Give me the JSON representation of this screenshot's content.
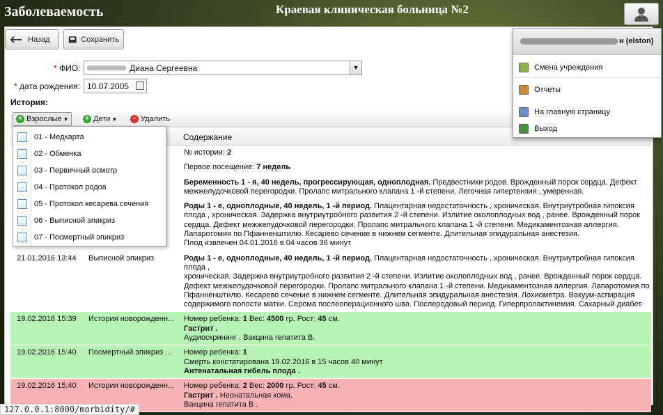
{
  "header": {
    "app_title": "Заболеваемость",
    "hospital": "Краевая клиническая больница №2"
  },
  "toolbar": {
    "back_label": "Назад",
    "save_label": "Сохранить"
  },
  "form": {
    "fio_label": "ФИО:",
    "fio_value": "Диана Сергеевна",
    "birth_label": "дата рождения:",
    "birth_value": "10.07.2005",
    "history_label": "История:"
  },
  "history_toolbar": {
    "adults": "Взрослые",
    "children": "Дети",
    "delete": "Удалить"
  },
  "table": {
    "header_content": "Содержание"
  },
  "rows": [
    {
      "date": "",
      "type": "",
      "lines": [
        [
          [
            "№ истории: ",
            false
          ],
          [
            "2",
            true
          ]
        ]
      ]
    },
    {
      "date": "",
      "type": "",
      "lines": [
        [
          [
            "Первое посещение: ",
            false
          ],
          [
            "7 недель",
            true
          ]
        ]
      ]
    },
    {
      "date": "",
      "type": "",
      "lines": [
        [
          [
            "Беременность 1 - я, 40 недель, прогрессирующая, одноплодная.",
            true
          ],
          [
            " Предвестники родов. Врожденный порок сердца. Дефект",
            false
          ]
        ],
        [
          [
            "межжелудочковой перегородки. Пролапс митрального клапана 1 -й степени. Легочная гипертензия , умеренная.",
            false
          ]
        ]
      ]
    },
    {
      "date": "",
      "type": "",
      "lines": [
        [
          [
            "Роды 1 - е, одноплодные, 40 недель, 1 -й период.",
            true
          ],
          [
            " Плацентарная недостаточность , хроническая. Внутриутробная гипоксия",
            false
          ]
        ],
        [
          [
            "плода , хроническая. Задержка внутриутробного развития 2 -й степени. Излитие околоплодных вод , ранее. Врожденный порок",
            false
          ]
        ],
        [
          [
            "сердца. Дефект межжелудочковой перегородки. Пролапс митрального клапана 1 -й степени. Медикаментозная аллергия.",
            false
          ]
        ],
        [
          [
            "Лапаротомия по Пфанненштилю. Кесарево сечение в нижнем сегменте. Длительная эпидуральная анестезия.",
            false
          ]
        ],
        [
          [
            "Плод извлечен 04.01.2016 в 04 часов 36 минут",
            false
          ]
        ]
      ]
    },
    {
      "date": "21.01.2016 13:44",
      "type": "Выписной эпикриз",
      "lines": [
        [
          [
            "Роды 1 - е, одноплодные, 40 недель, 1 -й период.",
            true
          ],
          [
            " Плацентарная недостаточность , хроническая. Внутриутробная гипоксия плода ,",
            false
          ]
        ],
        [
          [
            "хроническая. Задержка внутриутробного развития 2 -й степени. Излитие околоплодных вод , ранее. Врожденный порок сердца.",
            false
          ]
        ],
        [
          [
            "Дефект межжелудочковой перегородки. Пролапс митрального клапана 1 -й степени. Медикаментозная аллергия. Лапаротомия по",
            false
          ]
        ],
        [
          [
            "Пфанненштилю. Кесарево сечение в нижнем сегменте. Длительная эпидуральная анестезия. Лохиометра. Вакуум-аспирация",
            false
          ]
        ],
        [
          [
            "содержимого полости матки. Серома послеоперационного шва. Послеродовый период. Гиперпролактинемия. Сахарный диабет.",
            false
          ]
        ]
      ]
    },
    {
      "date": "19.02.2016 15:39",
      "type": "История новорожденн...",
      "bg": "#b7f3b7",
      "lines": [
        [
          [
            "Номер ребенка: ",
            false
          ],
          [
            "1",
            true
          ],
          [
            " Вес: ",
            false
          ],
          [
            "4500",
            true
          ],
          [
            " гр. Рост: ",
            false
          ],
          [
            "45",
            true
          ],
          [
            " см.",
            false
          ]
        ],
        [
          [
            "Гастрит .",
            true
          ]
        ],
        [
          [
            "Аудиоскрининг . Вакцина гепатита В.",
            false
          ]
        ]
      ]
    },
    {
      "date": "19.02.2016 15:40",
      "type": "Посмертный эпикриз ...",
      "bg": "#b7f3b7",
      "lines": [
        [
          [
            "Номер ребенка: ",
            false
          ],
          [
            "1",
            true
          ]
        ],
        [
          [
            "Смерть констатирована 19.02.2016 в 15 часов 40 минут",
            false
          ]
        ],
        [
          [
            "Антенатальная гибель плода .",
            true
          ]
        ]
      ]
    },
    {
      "date": "19.02.2016 15:40",
      "type": "История новорожденн...",
      "bg": "#f7b3b3",
      "lines": [
        [
          [
            "Номер ребенка: ",
            false
          ],
          [
            "2",
            true
          ],
          [
            " Вес: ",
            false
          ],
          [
            "2000",
            true
          ],
          [
            " гр. Рост: ",
            false
          ],
          [
            "45",
            true
          ],
          [
            " см.",
            false
          ]
        ],
        [
          [
            "Гастрит .",
            true
          ],
          [
            " Неонатальная кома.",
            false
          ]
        ],
        [
          [
            "Вакцина гепатита В .",
            false
          ]
        ]
      ]
    }
  ],
  "dropdown": [
    "01 - Медкарта",
    "02 - Обменка",
    "03 - Первичный осмотр",
    "04 - Протокол родов",
    "05 - Протокол кесарева сечения",
    "06 - Выписной эпикриз",
    "07 - Посмертный эпикриз"
  ],
  "user_menu": {
    "username": "н (elston)",
    "items": [
      {
        "label": "Смена учреждения",
        "icon": "building-icon"
      },
      {
        "label": "Отчеты",
        "icon": "report-icon"
      },
      {
        "label": "На главную страницу",
        "icon": "home-icon"
      },
      {
        "label": "Выход",
        "icon": "exit-icon"
      }
    ]
  },
  "status_url": "127.0.0.1:8000/morbidity/#",
  "colors": {
    "green_row": "#b7f3b7",
    "red_row": "#f7b3b3"
  }
}
